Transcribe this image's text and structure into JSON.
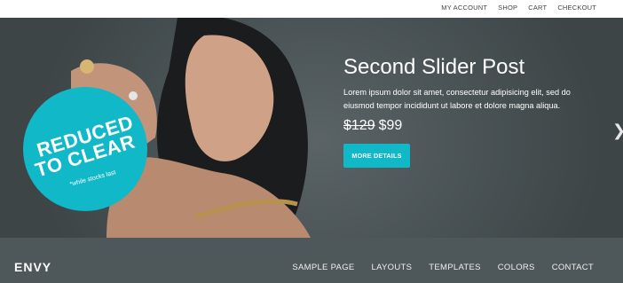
{
  "top_nav": [
    "MY ACCOUNT",
    "SHOP",
    "CART",
    "CHECKOUT"
  ],
  "slider": {
    "badge_line1": "REDUCED",
    "badge_line2": "TO CLEAR",
    "badge_note": "*while stocks last",
    "title": "Second Slider Post",
    "text": "Lorem ipsum dolor sit amet, consectetur adipisicing elit, sed do eiusmod tempor incididunt ut labore et dolore magna aliqua.",
    "price_old": "$129",
    "price_new": "$99",
    "button": "MORE DETAILS",
    "next_arrow": "❯"
  },
  "footer": {
    "logo": "ENVY",
    "nav": [
      "SAMPLE PAGE",
      "LAYOUTS",
      "TEMPLATES",
      "COLORS",
      "CONTACT"
    ]
  },
  "colors": {
    "accent": "#11b8c8",
    "hero_bg": "#485153",
    "footer_bg": "#4e575a"
  }
}
